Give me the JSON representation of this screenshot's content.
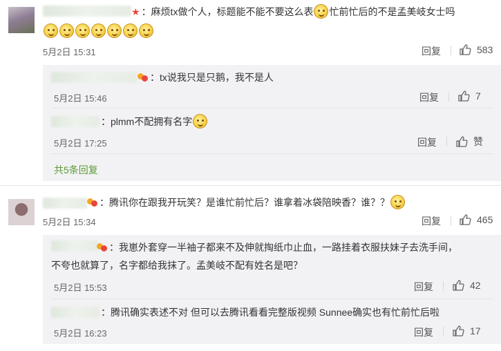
{
  "comments": [
    {
      "text": "：麻烦tx做个人，标题能不能不要这么表",
      "text_tail": "忙前忙后的不是孟美岐女士吗",
      "time": "5月2日 15:31",
      "reply_label": "回复",
      "likes": "583",
      "replies": [
        {
          "text": "：tx说我只是只鹅，我不是人",
          "time": "5月2日 15:46",
          "reply_label": "回复",
          "likes": "7"
        },
        {
          "text": "：plmm不配拥有名字",
          "time": "5月2日 17:25",
          "reply_label": "回复",
          "likes": "赞"
        }
      ],
      "expand_label": "共5条回复"
    },
    {
      "text": "：腾讯你在跟我开玩笑？是谁忙前忙后？谁拿着冰袋陪映香？谁？？",
      "time": "5月2日 15:34",
      "reply_label": "回复",
      "likes": "465",
      "replies": [
        {
          "text": "：我崽外套穿一半袖子都来不及伸就掏纸巾止血，一路挂着衣服扶妹子去洗手间，不夸也就算了，名字都给我抹了。孟美岐不配有姓名是吧？",
          "time": "5月2日 15:53",
          "reply_label": "回复",
          "likes": "42"
        },
        {
          "text": "：腾讯确实表述不对 但可以去腾讯看看完整版视频 Sunnee确实也有忙前忙后啦",
          "time": "5月2日 16:23",
          "reply_label": "回复",
          "likes": "17"
        }
      ]
    }
  ],
  "colors": {
    "link_green": "#5b9a33",
    "nested_bg": "#f2f2f5",
    "time_gray": "#666666"
  },
  "icons": [
    "star-icon",
    "vip-badge-icon",
    "smile-emoji-icon",
    "thumbs-up-icon"
  ]
}
